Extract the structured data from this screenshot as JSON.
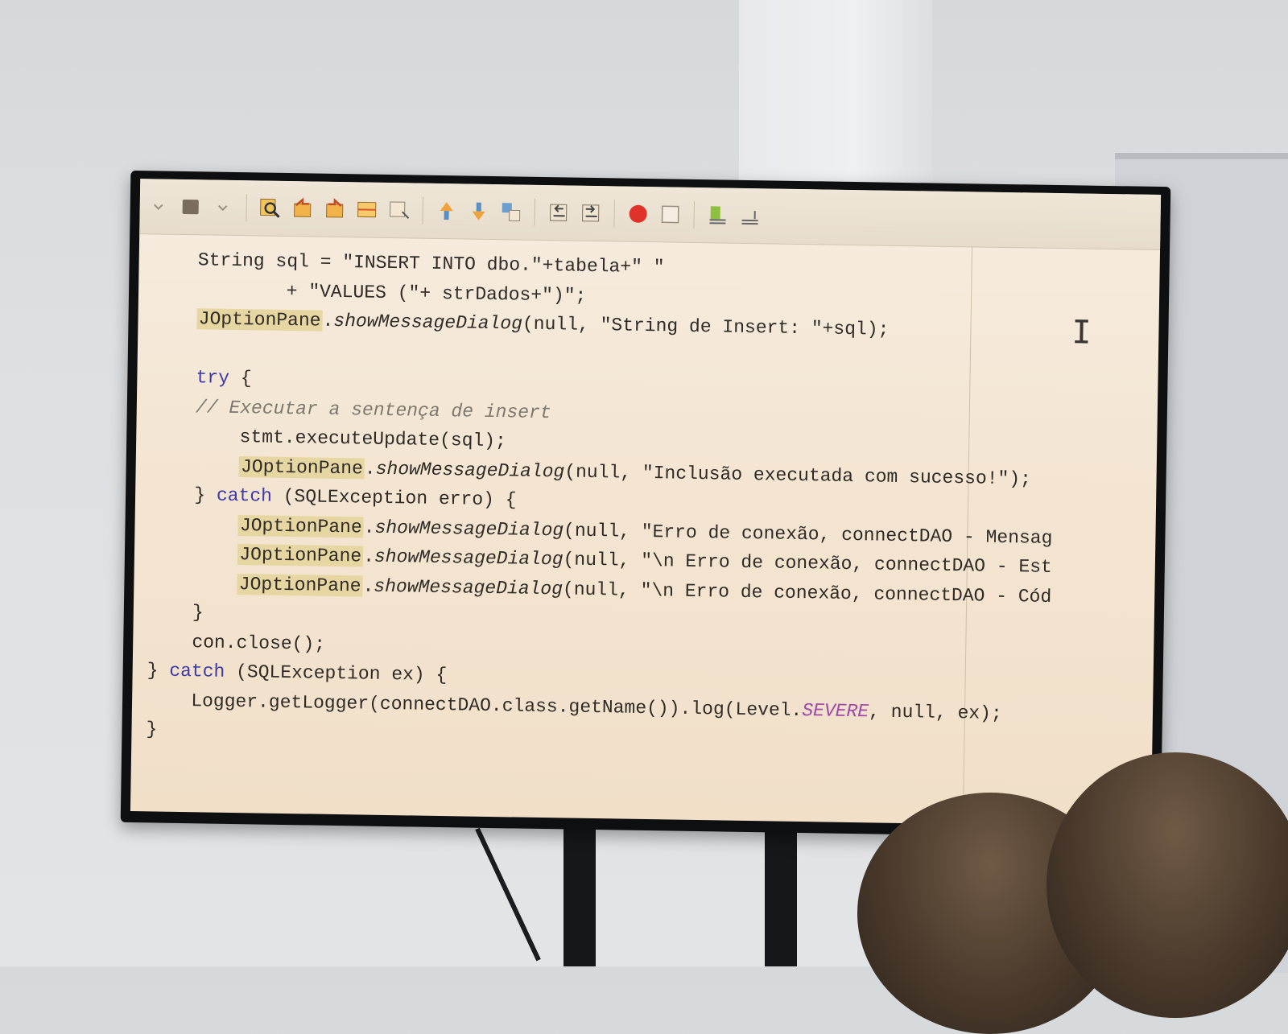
{
  "ide": {
    "toolbar_icons": [
      "dropdown-icon",
      "build-icon",
      "find-icon",
      "find-previous-icon",
      "find-next-icon",
      "toggle-highlight-icon",
      "find-selection-icon",
      "previous-bookmark-icon",
      "next-bookmark-icon",
      "toggle-bookmark-icon",
      "shift-left-icon",
      "shift-right-icon",
      "start-macro-recording-icon",
      "stop-macro-recording-icon",
      "comment-icon",
      "uncomment-icon"
    ],
    "code_lines": [
      {
        "indent": 2,
        "text": "String sql = \"INSERT INTO dbo.\"+tabela+\" \""
      },
      {
        "indent": 6,
        "text": "+ \"VALUES (\"+ strDados+\")\";"
      },
      {
        "indent": 2,
        "class": "JOptionPane",
        "method": "showMessageDialog",
        "rest": "(null, \"String de Insert: \"+sql);"
      },
      {
        "indent": 0,
        "text": ""
      },
      {
        "indent": 2,
        "keyword": "try",
        "rest": " {"
      },
      {
        "indent": 2,
        "comment": "// Executar a sentença de insert"
      },
      {
        "indent": 4,
        "text": "stmt.executeUpdate(sql);"
      },
      {
        "indent": 4,
        "class": "JOptionPane",
        "method": "showMessageDialog",
        "rest": "(null, \"Inclusão executada com sucesso!\");"
      },
      {
        "indent": 2,
        "prefix": "} ",
        "keyword": "catch",
        "rest": " (SQLException erro) {"
      },
      {
        "indent": 4,
        "class": "JOptionPane",
        "method": "showMessageDialog",
        "rest": "(null, \"Erro de conexão, connectDAO - Mensag"
      },
      {
        "indent": 4,
        "class": "JOptionPane",
        "method": "showMessageDialog",
        "rest": "(null, \"\\n Erro de conexão, connectDAO - Est"
      },
      {
        "indent": 4,
        "class": "JOptionPane",
        "method": "showMessageDialog",
        "rest": "(null, \"\\n Erro de conexão, connectDAO - Cód"
      },
      {
        "indent": 2,
        "text": "}"
      },
      {
        "indent": 2,
        "text": "con.close();"
      },
      {
        "indent": 0,
        "prefix": "} ",
        "keyword": "catch",
        "rest": " (SQLException ex) {"
      },
      {
        "indent": 2,
        "text": "Logger.getLogger(connectDAO.class.getName()).log(Level.",
        "constant": "SEVERE",
        "rest": ", null, ex);"
      },
      {
        "indent": 0,
        "text": "}"
      }
    ]
  },
  "colors": {
    "screen_bg": "#f4e6d4",
    "class_highlight": "#e6d6a1",
    "record_red": "#e0322a"
  }
}
